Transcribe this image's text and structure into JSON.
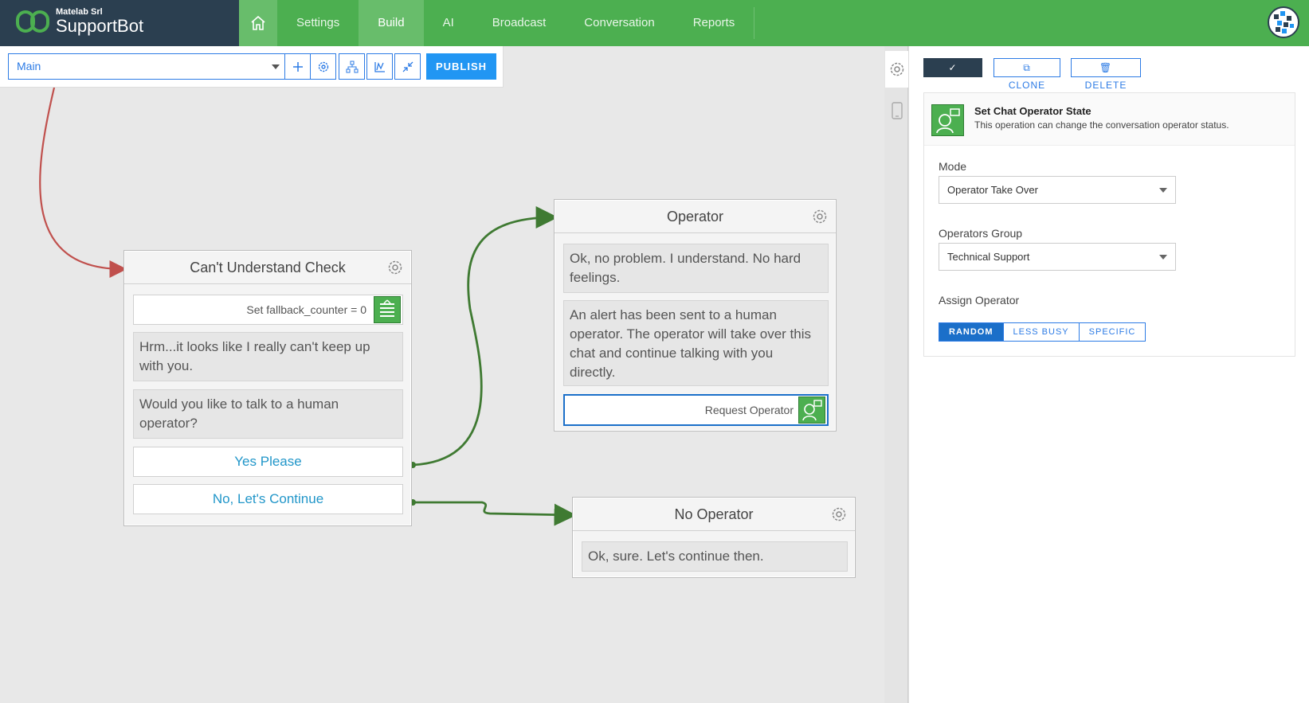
{
  "brand": {
    "company": "Matelab Srl",
    "name": "SupportBot"
  },
  "nav": {
    "items": [
      {
        "label": "Settings",
        "active": false
      },
      {
        "label": "Build",
        "active": true
      },
      {
        "label": "AI",
        "active": false
      },
      {
        "label": "Broadcast",
        "active": false
      },
      {
        "label": "Conversation",
        "active": false
      },
      {
        "label": "Reports",
        "active": false
      }
    ]
  },
  "toolbar": {
    "flow_value": "Main",
    "tools": [
      "add-icon",
      "gear-icon",
      "tree-icon",
      "chart-icon",
      "collapse-icon"
    ],
    "publish_label": "PUBLISH"
  },
  "nodes": {
    "cant_understand": {
      "title": "Can't Understand Check",
      "set_var": "Set fallback_counter = 0",
      "msg1": "Hrm...it looks like I really can't keep up with you.",
      "msg2": "Would you like to talk to a human operator?",
      "reply_yes": "Yes Please",
      "reply_no": "No, Let's Continue"
    },
    "operator": {
      "title": "Operator",
      "msg1": "Ok, no problem. I understand. No hard feelings.",
      "msg2": "An alert has been sent to a human operator. The operator will take over this chat and continue talking with you directly.",
      "action": "Request Operator"
    },
    "no_operator": {
      "title": "No Operator",
      "msg1": "Ok, sure. Let's continue then."
    }
  },
  "panel": {
    "save_label": "SAVE",
    "clone_label": "CLONE",
    "delete_label": "DELETE",
    "card_title": "Set Chat Operator State",
    "card_sub": "This operation can change the conversation operator status.",
    "mode_label": "Mode",
    "mode_value": "Operator Take Over",
    "group_label": "Operators Group",
    "group_value": "Technical Support",
    "assign_label": "Assign Operator",
    "assign_options": [
      {
        "label": "RANDOM",
        "selected": true
      },
      {
        "label": "LESS BUSY",
        "selected": false
      },
      {
        "label": "SPECIFIC",
        "selected": false
      }
    ]
  },
  "colors": {
    "nav_green": "#4caf50",
    "brand_dark": "#2b3f50",
    "accent_blue": "#2196f3",
    "link_red": "#c0504d",
    "link_green": "#3f7a32"
  }
}
